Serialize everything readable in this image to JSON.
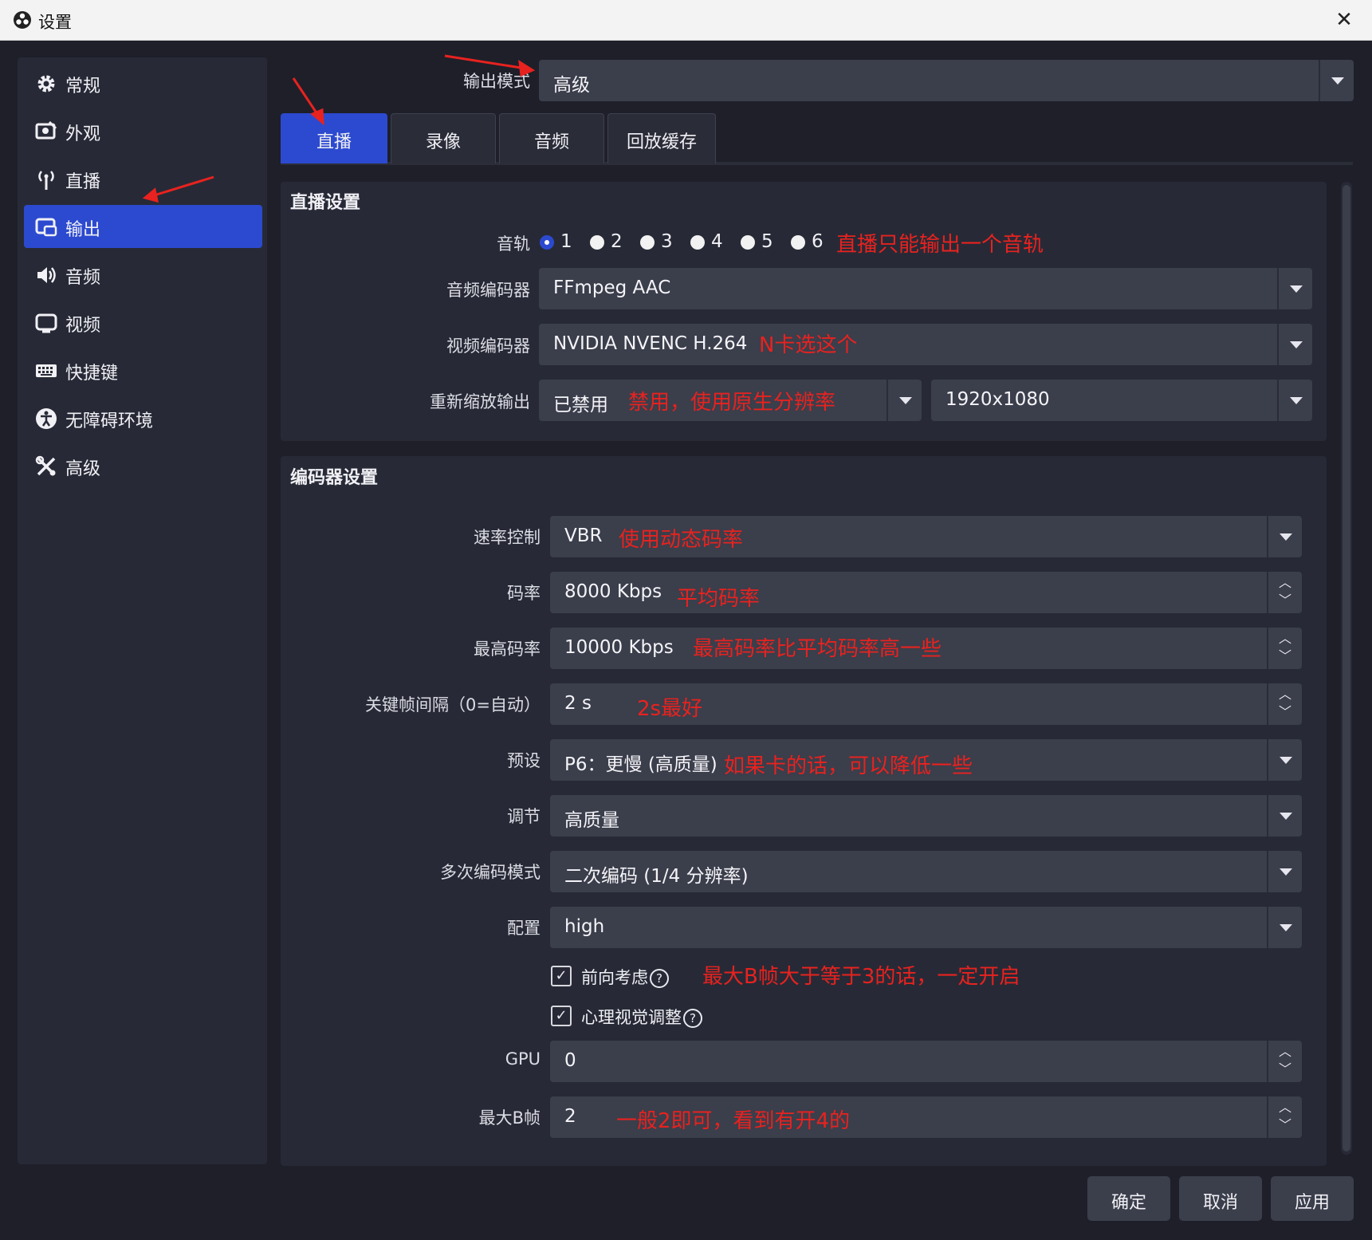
{
  "window": {
    "title": "设置",
    "close_glyph": "✕"
  },
  "sidebar": {
    "items": [
      {
        "label": "常规",
        "icon": "gear-icon"
      },
      {
        "label": "外观",
        "icon": "appearance-icon"
      },
      {
        "label": "直播",
        "icon": "antenna-icon"
      },
      {
        "label": "输出",
        "icon": "output-icon",
        "active": true
      },
      {
        "label": "音频",
        "icon": "speaker-icon"
      },
      {
        "label": "视频",
        "icon": "monitor-icon"
      },
      {
        "label": "快捷键",
        "icon": "keyboard-icon"
      },
      {
        "label": "无障碍环境",
        "icon": "accessibility-icon"
      },
      {
        "label": "高级",
        "icon": "tools-icon"
      }
    ]
  },
  "output_mode": {
    "label": "输出模式",
    "value": "高级"
  },
  "tabs": [
    {
      "label": "直播",
      "active": true
    },
    {
      "label": "录像"
    },
    {
      "label": "音频"
    },
    {
      "label": "回放缓存"
    }
  ],
  "stream_settings": {
    "title": "直播设置",
    "audio_track": {
      "label": "音轨",
      "options": [
        "1",
        "2",
        "3",
        "4",
        "5",
        "6"
      ],
      "selected": "1",
      "note": "直播只能输出一个音轨"
    },
    "audio_encoder": {
      "label": "音频编码器",
      "value": "FFmpeg AAC"
    },
    "video_encoder": {
      "label": "视频编码器",
      "value": "NVIDIA NVENC H.264",
      "note": "N卡选这个"
    },
    "rescale": {
      "label": "重新缩放输出",
      "value": "已禁用",
      "note": "禁用，使用原生分辨率",
      "resolution": "1920x1080"
    }
  },
  "encoder_settings": {
    "title": "编码器设置",
    "rate_control": {
      "label": "速率控制",
      "value": "VBR",
      "note": "使用动态码率"
    },
    "bitrate": {
      "label": "码率",
      "value": "8000 Kbps",
      "note": "平均码率"
    },
    "max_bitrate": {
      "label": "最高码率",
      "value": "10000 Kbps",
      "note": "最高码率比平均码率高一些"
    },
    "keyframe": {
      "label": "关键帧间隔（0=自动）",
      "value": "2 s",
      "note": "2s最好"
    },
    "preset": {
      "label": "预设",
      "value": "P6：更慢 (高质量)",
      "note": "如果卡的话，可以降低一些"
    },
    "tuning": {
      "label": "调节",
      "value": "高质量"
    },
    "multipass": {
      "label": "多次编码模式",
      "value": "二次编码 (1/4 分辨率)"
    },
    "profile": {
      "label": "配置",
      "value": "high"
    },
    "lookahead": {
      "label": "前向考虑",
      "checked": true,
      "note": "最大B帧大于等于3的话，一定开启"
    },
    "psycho_visual": {
      "label": "心理视觉调整",
      "checked": true
    },
    "gpu": {
      "label": "GPU",
      "value": "0"
    },
    "max_bframes": {
      "label": "最大B帧",
      "value": "2",
      "note": "一般2即可，看到有开4的"
    }
  },
  "footer": {
    "ok": "确定",
    "cancel": "取消",
    "apply": "应用"
  },
  "glyphs": {
    "check": "✓",
    "help": "?",
    "up": "︿",
    "down": "﹀"
  },
  "colors": {
    "accent": "#2c4ad0",
    "annotation": "#e8221f",
    "panel": "#272a36",
    "field": "#3b3e4b",
    "background": "#1e1f29"
  }
}
